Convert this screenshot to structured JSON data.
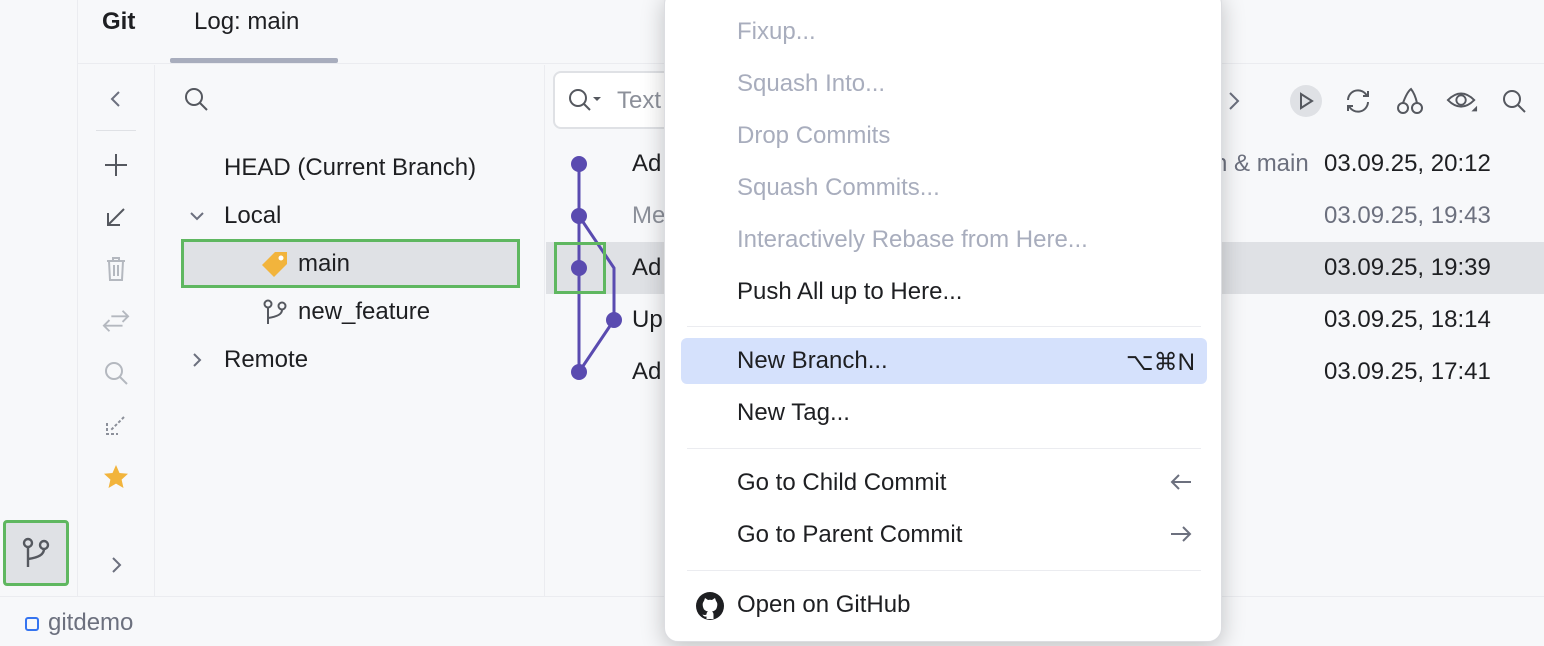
{
  "header": {
    "tool_name": "Git",
    "active_tab": "Log: main"
  },
  "branches": {
    "head": "HEAD (Current Branch)",
    "local_group": "Local",
    "local_items": [
      "main",
      "new_feature"
    ],
    "remote_group": "Remote"
  },
  "log": {
    "filter_placeholder": "Text",
    "rows": [
      {
        "subject": "Ad",
        "refs": "n & main",
        "date": "03.09.25, 20:12"
      },
      {
        "subject": "Me",
        "refs": "",
        "date": "03.09.25, 19:43"
      },
      {
        "subject": "Ad",
        "refs": "",
        "date": "03.09.25, 19:39"
      },
      {
        "subject": "Up",
        "refs": "",
        "date": "03.09.25, 18:14"
      },
      {
        "subject": "Ad",
        "refs": "",
        "date": "03.09.25, 17:41"
      }
    ]
  },
  "menu": {
    "fixup": "Fixup...",
    "squash_into": "Squash Into...",
    "drop_commits": "Drop Commits",
    "squash_commits": "Squash Commits...",
    "interactive_rebase": "Interactively Rebase from Here...",
    "push_all": "Push All up to Here...",
    "new_branch": "New Branch...",
    "new_branch_shortcut": "⌥⌘N",
    "new_tag": "New Tag...",
    "go_child": "Go to Child Commit",
    "go_parent": "Go to Parent Commit",
    "open_github": "Open on GitHub"
  },
  "status": {
    "project": "gitdemo"
  },
  "colors": {
    "accent": "#3574f0",
    "graph": "#5a4bb0",
    "highlight": "#5fb760",
    "menu_highlight": "#d5e1fc"
  }
}
